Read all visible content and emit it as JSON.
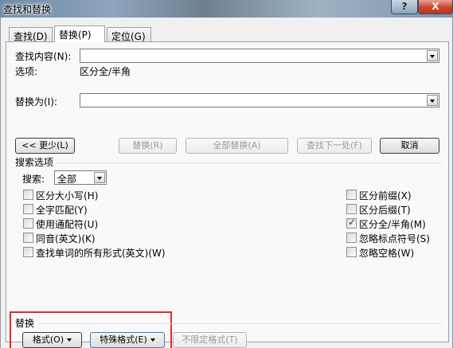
{
  "window": {
    "title": "查找和替换",
    "help_label": "?",
    "close_label": "X"
  },
  "tabs": [
    {
      "label": "查找(D)",
      "active": false
    },
    {
      "label": "替换(P)",
      "active": true
    },
    {
      "label": "定位(G)",
      "active": false
    }
  ],
  "find": {
    "label": "查找内容(N):",
    "value": "",
    "options_label": "选项:",
    "options_value": "区分全/半角"
  },
  "replace": {
    "label": "替换为(I):",
    "value": ""
  },
  "buttons": {
    "less": "<< 更少(L)",
    "replace": "替换(R)",
    "replace_all": "全部替换(A)",
    "find_next": "查找下一处(F)",
    "cancel": "取消"
  },
  "search_options": {
    "heading": "搜索选项",
    "search_label": "搜索:",
    "search_value": "全部",
    "left_checkboxes": [
      {
        "label": "区分大小写(H)",
        "checked": false
      },
      {
        "label": "全字匹配(Y)",
        "checked": false
      },
      {
        "label": "使用通配符(U)",
        "checked": false
      },
      {
        "label": "同音(英文)(K)",
        "checked": false
      },
      {
        "label": "查找单词的所有形式(英文)(W)",
        "checked": false
      }
    ],
    "right_checkboxes": [
      {
        "label": "区分前缀(X)",
        "checked": false
      },
      {
        "label": "区分后缀(T)",
        "checked": false
      },
      {
        "label": "区分全/半角(M)",
        "checked": true
      },
      {
        "label": "忽略标点符号(S)",
        "checked": false
      },
      {
        "label": "忽略空格(W)",
        "checked": false
      }
    ]
  },
  "replace_section": {
    "heading": "替换",
    "format_label": "格式(O)",
    "special_label": "特殊格式(E)",
    "no_format_label": "不限定格式(T)"
  },
  "colors": {
    "highlight_border": "#e02b2b",
    "close_button": "#c8442d",
    "checkmark": "#1f3a6b"
  }
}
